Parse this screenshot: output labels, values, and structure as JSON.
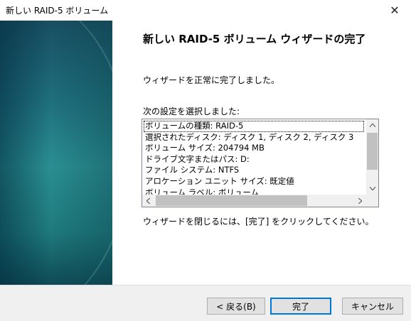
{
  "window": {
    "title": "新しい RAID-5 ボリューム",
    "close_glyph": "✕"
  },
  "main": {
    "heading": "新しい RAID-5 ボリューム ウィザードの完了",
    "completed_text": "ウィザードを正常に完了しました。",
    "selected_label": "次の設定を選択しました:",
    "settings": [
      "ボリュームの種類: RAID-5",
      "選択されたディスク: ディスク 1, ディスク 2, ディスク 3",
      "ボリューム サイズ: 204794 MB",
      "ドライブ文字またはパス: D:",
      "ファイル システム: NTFS",
      "アロケーション ユニット サイズ: 既定値",
      "ボリューム ラベル: ボリューム"
    ],
    "close_hint": "ウィザードを閉じるには、[完了] をクリックしてください。"
  },
  "buttons": {
    "back": "< 戻る(B)",
    "finish": "完了",
    "cancel": "キャンセル"
  },
  "icons": {
    "close": "close-icon",
    "scroll_up": "chevron-up-icon",
    "scroll_down": "chevron-down-icon",
    "scroll_left": "chevron-left-icon",
    "scroll_right": "chevron-right-icon"
  },
  "colors": {
    "accent": "#0078d7",
    "side_panel": "#1f6f7d",
    "footer": "#f0f0f0"
  }
}
